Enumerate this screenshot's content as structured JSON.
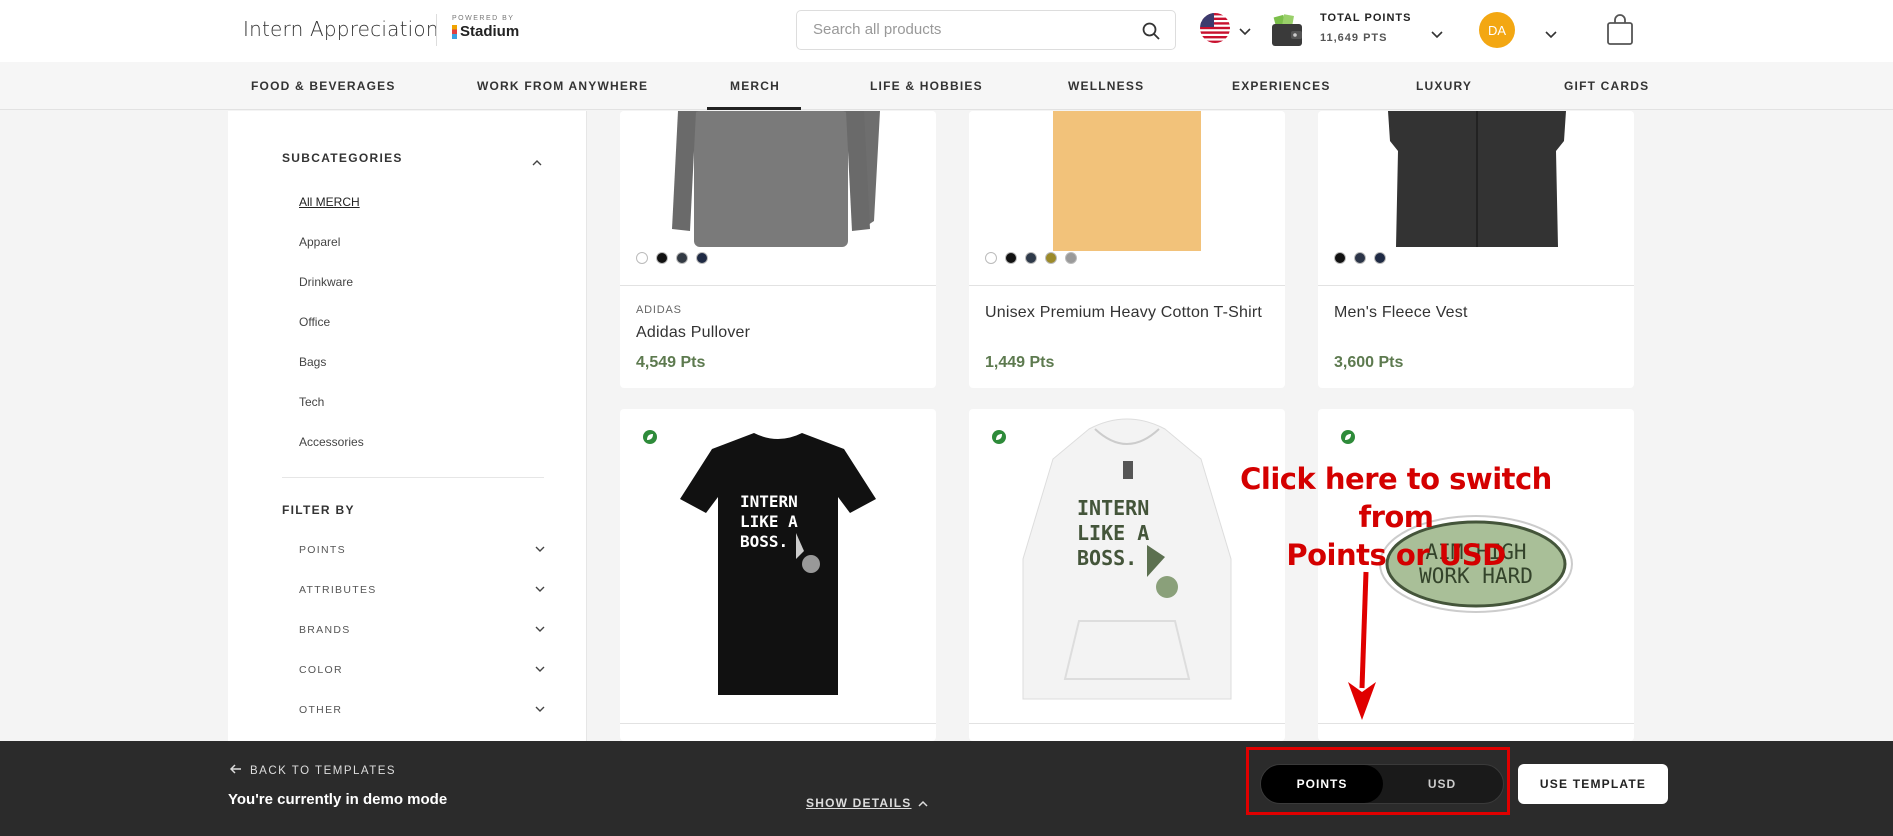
{
  "header": {
    "brand": "Intern Appreciation",
    "powered_by": "POWERED BY",
    "partner": "Stadium",
    "search_placeholder": "Search all products",
    "points_label": "TOTAL POINTS",
    "points_value": "11,649 PTS",
    "avatar_initials": "DA"
  },
  "nav": {
    "items": [
      "FOOD & BEVERAGES",
      "WORK FROM ANYWHERE",
      "MERCH",
      "LIFE & HOBBIES",
      "WELLNESS",
      "EXPERIENCES",
      "LUXURY",
      "GIFT CARDS"
    ],
    "active": "MERCH"
  },
  "sidebar": {
    "subcategories_heading": "SUBCATEGORIES",
    "subcategories": [
      "All MERCH",
      "Apparel",
      "Drinkware",
      "Office",
      "Bags",
      "Tech",
      "Accessories"
    ],
    "filter_heading": "FILTER BY",
    "filters": [
      "POINTS",
      "ATTRIBUTES",
      "BRANDS",
      "COLOR",
      "OTHER"
    ]
  },
  "products": [
    {
      "brand": "ADIDAS",
      "name": "Adidas Pullover",
      "price": "4,549 Pts",
      "swatches": [
        "#ffffff",
        "#111111",
        "#333a44",
        "#1f2a44"
      ]
    },
    {
      "brand": "",
      "name": "Unisex Premium Heavy Cotton T-Shirt",
      "price": "1,449 Pts",
      "swatches": [
        "#ffffff",
        "#111111",
        "#2f3a4a",
        "#9c8a2a",
        "#9a9a9a"
      ]
    },
    {
      "brand": "",
      "name": "Men's Fleece Vest",
      "price": "3,600 Pts",
      "swatches": [
        "#111111",
        "#2c3548",
        "#1f2a44"
      ]
    }
  ],
  "product_art": {
    "tshirt_text": [
      "INTERN",
      "LIKE A",
      "BOSS."
    ],
    "hoodie_text": [
      "INTERN",
      "LIKE A",
      "BOSS."
    ],
    "sticker_text": [
      "AIM HIGH",
      "WORK HARD"
    ]
  },
  "annotation": {
    "text_line1": "Click here to switch from",
    "text_line2": "Points or USD",
    "color": "#d40000"
  },
  "bottom_bar": {
    "back_label": "BACK TO TEMPLATES",
    "demo_text": "You're currently in demo mode",
    "show_details": "SHOW DETAILS",
    "toggle_points": "POINTS",
    "toggle_usd": "USD",
    "toggle_selected": "POINTS",
    "use_template": "USE TEMPLATE"
  },
  "colors": {
    "price_green": "#5d7a4f",
    "avatar_orange": "#f3a712",
    "bottom_bar": "#2b2b2b"
  }
}
